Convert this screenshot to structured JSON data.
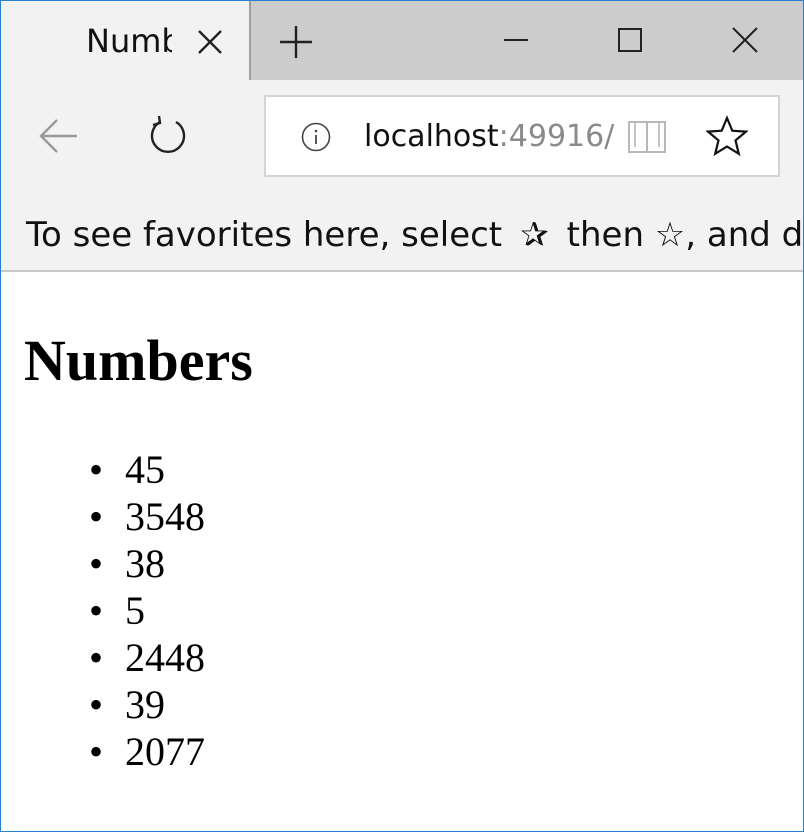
{
  "browser": {
    "tab_title": "Numbers",
    "address": {
      "host": "localhost",
      "port": ":49916/"
    },
    "favorites_bar": {
      "text_before": "To see favorites here, select",
      "glyph_1": "✰",
      "text_middle": "then ☆, and drag to the Favorites Bar folder."
    },
    "icons": [
      "close-icon",
      "plus-icon",
      "minimize-icon",
      "maximize-icon",
      "back-icon",
      "refresh-icon",
      "info-icon",
      "reading-view-icon",
      "star-icon"
    ]
  },
  "page": {
    "heading": "Numbers",
    "numbers": [
      "45",
      "3548",
      "38",
      "5",
      "2448",
      "39",
      "2077"
    ]
  },
  "colors": {
    "window_border": "#2b7fd0",
    "chrome_bg": "#f2f2f2",
    "tabstrip_bg": "#cccccc"
  }
}
